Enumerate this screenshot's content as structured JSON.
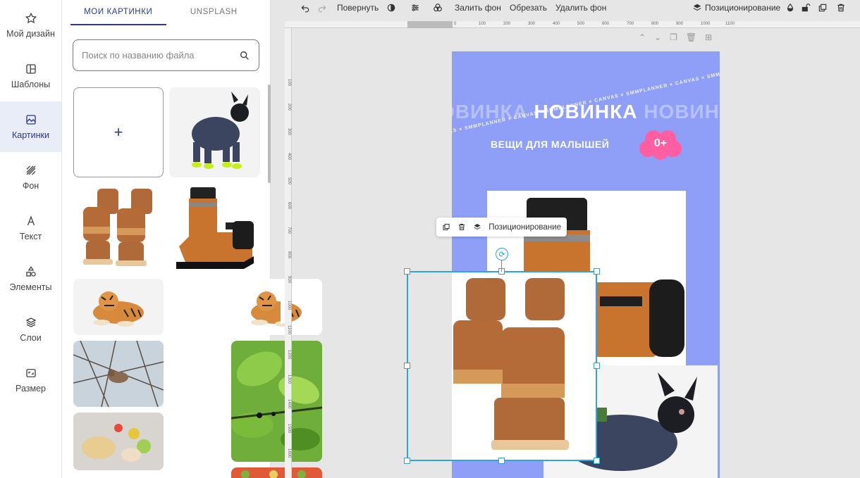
{
  "sidebar": {
    "items": [
      {
        "label": "Мой дизайн",
        "icon": "star-icon",
        "active": false
      },
      {
        "label": "Шаблоны",
        "icon": "template-icon",
        "active": false
      },
      {
        "label": "Картинки",
        "icon": "image-icon",
        "active": true
      },
      {
        "label": "Фон",
        "icon": "background-icon",
        "active": false
      },
      {
        "label": "Текст",
        "icon": "text-icon",
        "active": false
      },
      {
        "label": "Элементы",
        "icon": "shapes-icon",
        "active": false
      },
      {
        "label": "Слои",
        "icon": "layers-icon",
        "active": false
      },
      {
        "label": "Размер",
        "icon": "resize-icon",
        "active": false
      }
    ]
  },
  "images_panel": {
    "tabs": [
      "МОИ КАРТИНКИ",
      "UNSPLASH"
    ],
    "active_tab": "МОИ КАРТИНКИ",
    "search_placeholder": "Поиск по названию файла",
    "add_symbol": "+",
    "thumbnails": [
      "dog-in-denim",
      "brown-boots",
      "orange-dog-boots",
      "tiger-lying",
      "tiger-lying-cutout",
      "bird-on-branch",
      "green-leaves",
      "bread-and-vegetables",
      "salad"
    ]
  },
  "toolbar": {
    "rotate_label": "Повернуть",
    "fill_bg_label": "Залить фон",
    "crop_label": "Обрезать",
    "remove_bg_label": "Удалить фон",
    "positioning_label": "Позиционирование"
  },
  "rulers": {
    "horizontal": [
      "0",
      "100",
      "200",
      "300",
      "400",
      "500",
      "600",
      "700",
      "800",
      "900",
      "1000",
      "1100"
    ],
    "vertical": [
      "100",
      "200",
      "300",
      "400",
      "500",
      "600",
      "700",
      "800",
      "900",
      "1000",
      "1100",
      "1200",
      "1300",
      "1400",
      "1500",
      "1600"
    ]
  },
  "design": {
    "ribbon_text": "CANVAS × SMMPLANNER × CANVAS × SMMPLANNER × CANVAS × SMMPLANNER × CANVAS × SMMPLANNER ×",
    "headline": "НОВИНКА",
    "headline_ghost": "НОВИНКА",
    "subline": "ВЕЩИ ДЛЯ МАЛЫШЕЙ",
    "badge": "0+",
    "bg_color": "#8f9ff7",
    "badge_color": "#ff5fa2"
  },
  "floating_toolbar": {
    "positioning_label": "Позиционирование"
  },
  "colors": {
    "accent": "#2a3a8c",
    "selection": "#2aa6e0"
  }
}
